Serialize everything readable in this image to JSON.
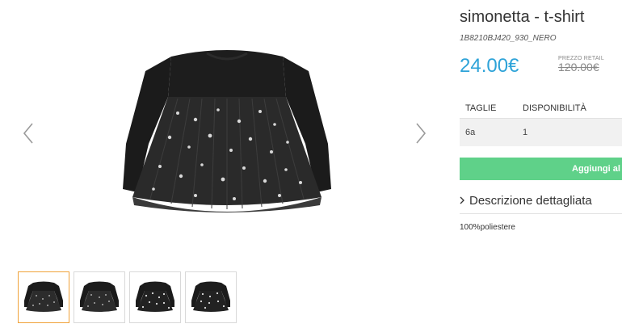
{
  "product": {
    "title": "simonetta - t-shirt",
    "sku": "1B8210BJ420_930_NERO",
    "price": "24.00€",
    "retail_label": "PREZZO RETAIL",
    "retail_price": "120.00€"
  },
  "sizes": {
    "header_size": "TAGLIE",
    "header_availability": "DISPONIBILITÀ",
    "rows": [
      {
        "size": "6a",
        "availability": "1"
      }
    ]
  },
  "cart": {
    "add_label": "Aggiungi al c"
  },
  "description": {
    "toggle_label": "Descrizione dettagliata",
    "text": "100%poliestere"
  },
  "gallery": {
    "thumbnail_count": 4,
    "active_thumbnail": 1
  },
  "colors": {
    "price": "#2ea3d8",
    "add_button": "#5fd189",
    "active_thumb_border": "#f0a23a"
  },
  "icons": {
    "prev": "chevron-left-icon",
    "next": "chevron-right-icon",
    "toggle": "chevron-right-icon"
  }
}
